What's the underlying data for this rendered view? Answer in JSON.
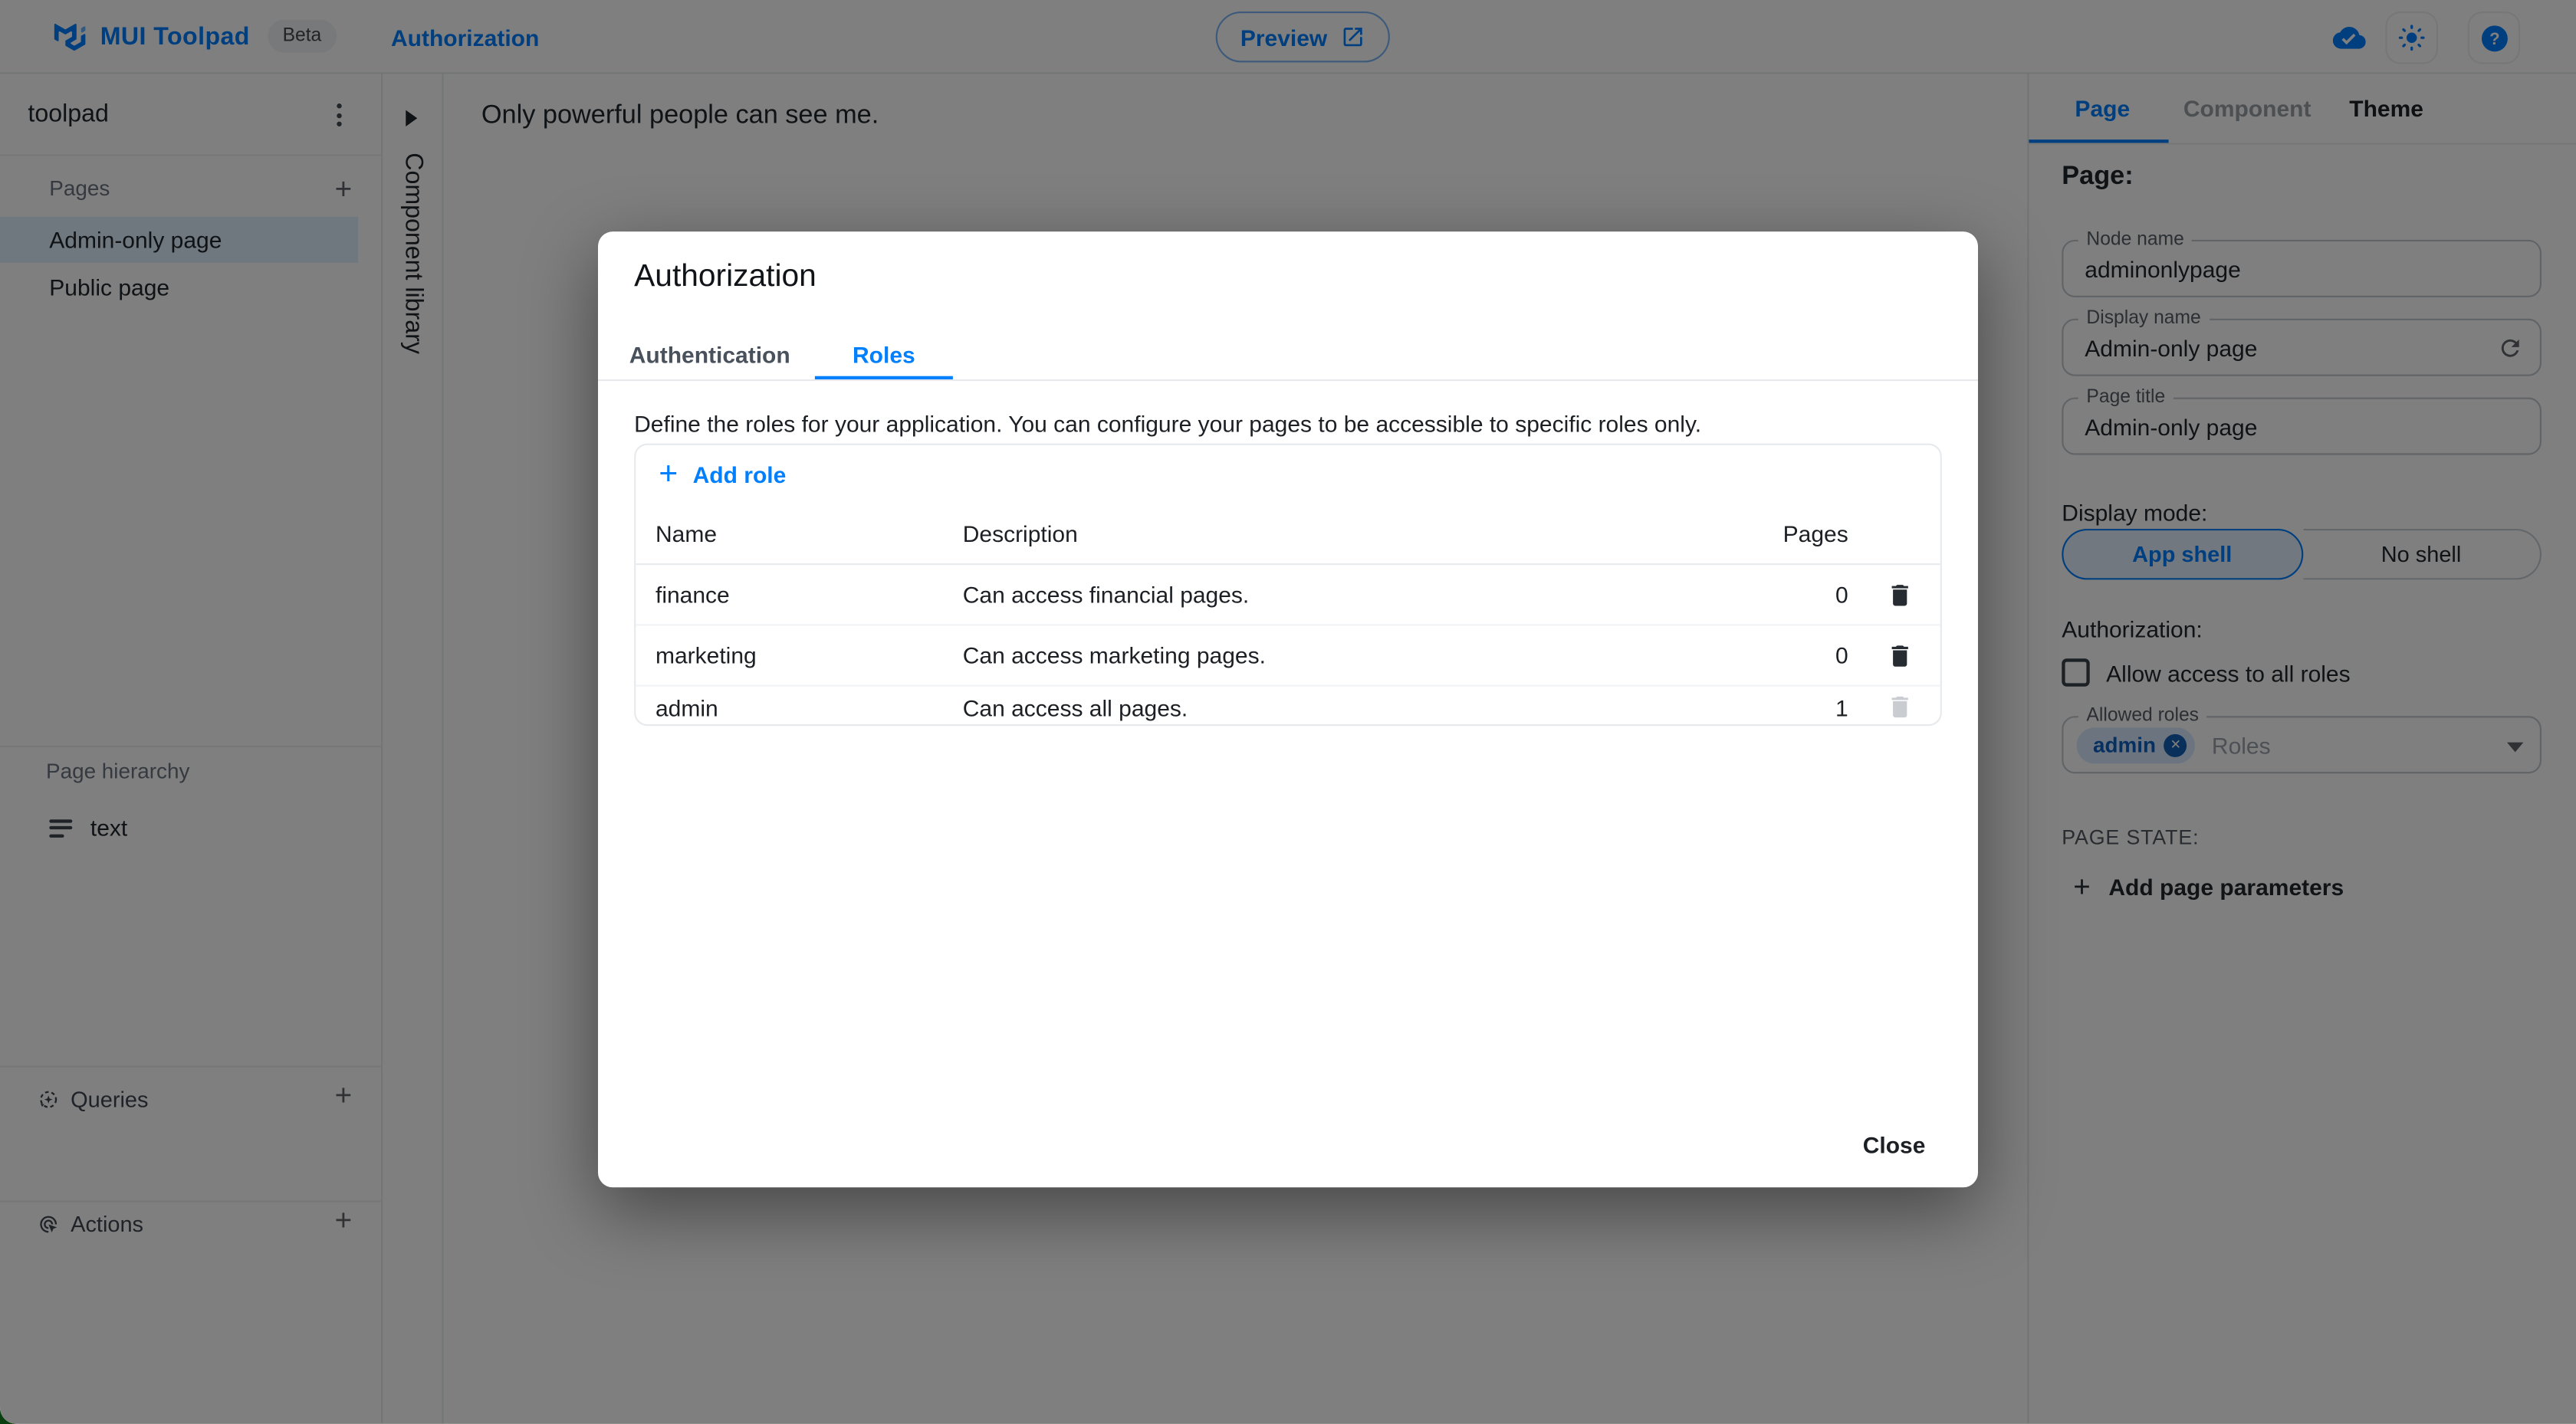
{
  "header": {
    "app_title": "MUI Toolpad",
    "beta_badge": "Beta",
    "breadcrumb": "Authorization",
    "preview_label": "Preview"
  },
  "sidebar": {
    "project_name": "toolpad",
    "pages_label": "Pages",
    "pages": [
      {
        "label": "Admin-only page",
        "selected": true
      },
      {
        "label": "Public page",
        "selected": false
      }
    ],
    "hierarchy_label": "Page hierarchy",
    "hierarchy_item": {
      "label": "text"
    },
    "queries_label": "Queries",
    "actions_label": "Actions"
  },
  "component_library": {
    "label": "Component library"
  },
  "canvas": {
    "text": "Only powerful people can see me."
  },
  "dialog": {
    "title": "Authorization",
    "tabs": [
      {
        "label": "Authentication",
        "active": false
      },
      {
        "label": "Roles",
        "active": true
      }
    ],
    "description": "Define the roles for your application. You can configure your pages to be accessible to specific roles only.",
    "add_role_label": "Add role",
    "table": {
      "columns": [
        "Name",
        "Description",
        "Pages"
      ],
      "rows": [
        {
          "name": "finance",
          "description": "Can access financial pages.",
          "pages": "0",
          "deletable": true
        },
        {
          "name": "marketing",
          "description": "Can access marketing pages.",
          "pages": "0",
          "deletable": true
        },
        {
          "name": "admin",
          "description": "Can access all pages.",
          "pages": "1",
          "deletable": false
        }
      ]
    },
    "close_label": "Close"
  },
  "inspector": {
    "tabs": [
      {
        "label": "Page",
        "active": true
      },
      {
        "label": "Component",
        "active": false
      },
      {
        "label": "Theme",
        "active": false
      }
    ],
    "heading": "Page:",
    "fields": [
      {
        "label": "Node name",
        "value": "adminonlypage"
      },
      {
        "label": "Display name",
        "value": "Admin-only page"
      },
      {
        "label": "Page title",
        "value": "Admin-only page"
      }
    ],
    "display_mode": {
      "label": "Display mode:",
      "options": [
        {
          "label": "App shell",
          "selected": true
        },
        {
          "label": "No shell",
          "selected": false
        }
      ]
    },
    "authorization": {
      "label": "Authorization:",
      "checkbox_label": "Allow access to all roles",
      "allowed_roles_label": "Allowed roles",
      "chip": "admin",
      "placeholder": "Roles"
    },
    "page_state_label": "PAGE STATE:",
    "add_page_parameters_label": "Add page parameters"
  },
  "colors": {
    "accent_blue": "#007FFF",
    "selected_item_bg": "#E0F0FF",
    "chip_bg": "#D8EBFF",
    "chip_text": "#0b61c2",
    "backdrop": "rgba(0,0,0,0.5)",
    "border_light": "#e7e9ec",
    "text_primary": "#1c2025",
    "text_secondary": "#6b7280"
  }
}
